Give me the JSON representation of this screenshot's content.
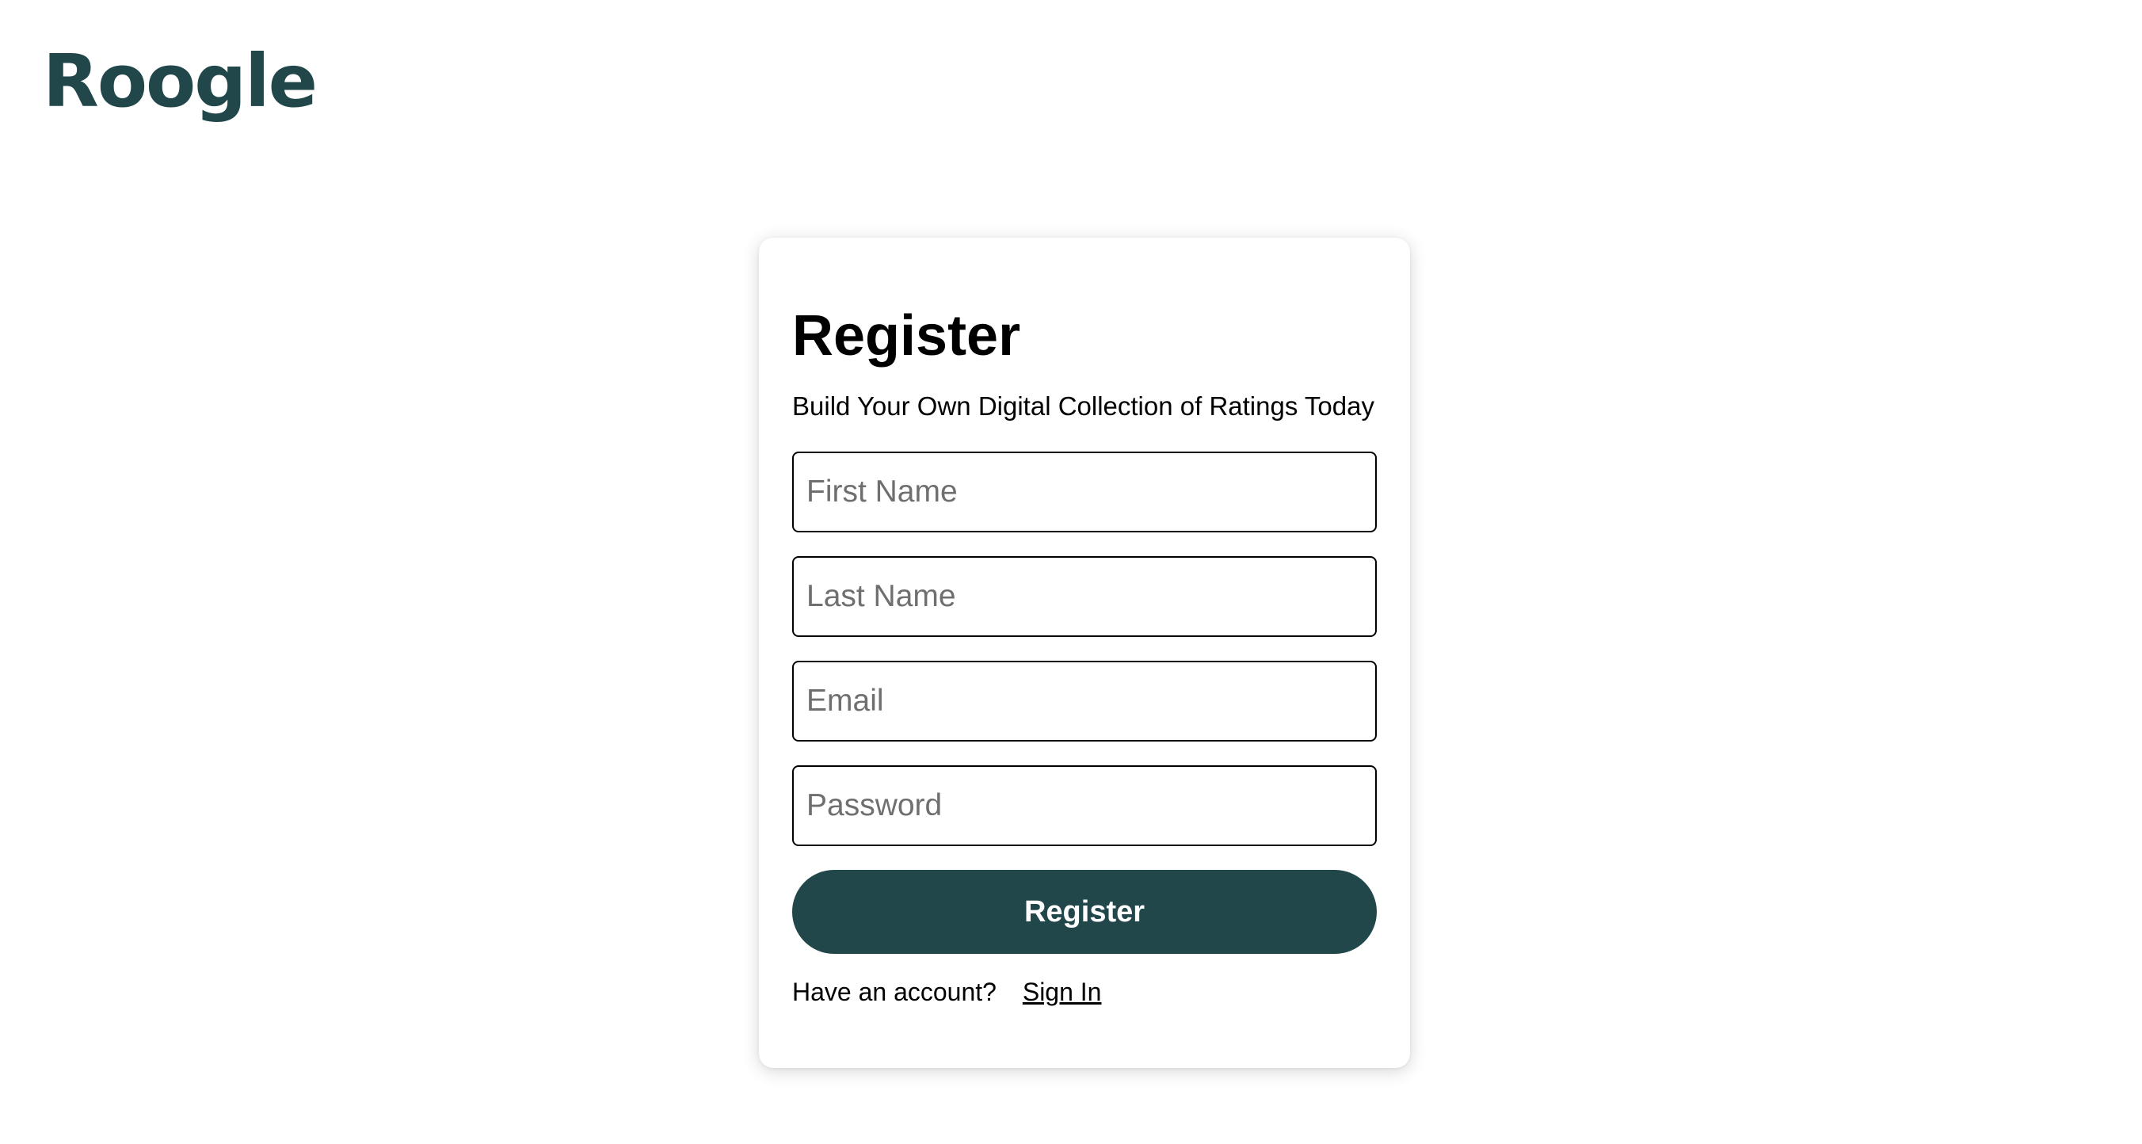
{
  "brand": {
    "logo_text": "Roogle",
    "color": "#21474a"
  },
  "register_form": {
    "title": "Register",
    "subtitle": "Build Your Own Digital Collection of Ratings Today",
    "fields": {
      "first_name": {
        "value": "",
        "placeholder": "First Name"
      },
      "last_name": {
        "value": "",
        "placeholder": "Last Name"
      },
      "email": {
        "value": "",
        "placeholder": "Email"
      },
      "password": {
        "value": "",
        "placeholder": "Password"
      }
    },
    "submit_label": "Register",
    "submit_color": "#21474a",
    "signin_prompt": "Have an account?",
    "signin_link": "Sign In"
  }
}
